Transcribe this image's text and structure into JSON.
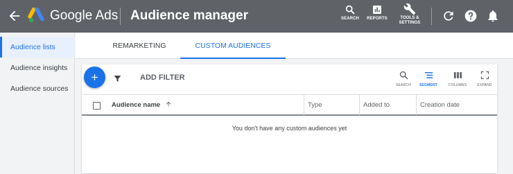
{
  "header": {
    "brand": "Google Ads",
    "title": "Audience manager",
    "tools": [
      {
        "icon": "search-icon",
        "label": "SEARCH"
      },
      {
        "icon": "reports-icon",
        "label": "REPORTS"
      },
      {
        "icon": "wrench-icon",
        "label_line1": "TOOLS &",
        "label_line2": "SETTINGS"
      }
    ],
    "icons": [
      "refresh-icon",
      "help-icon",
      "notifications-bell-icon"
    ]
  },
  "sidebar": {
    "items": [
      {
        "label": "Audience lists",
        "active": true
      },
      {
        "label": "Audience insights",
        "active": false
      },
      {
        "label": "Audience sources",
        "active": false
      }
    ]
  },
  "tabs": [
    {
      "label": "REMARKETING",
      "active": false
    },
    {
      "label": "CUSTOM AUDIENCES",
      "active": true
    }
  ],
  "toolbar": {
    "add_filter": "ADD FILTER",
    "tools": [
      {
        "icon": "search-icon",
        "label": "SEARCH"
      },
      {
        "icon": "segment-icon",
        "label": "SEGMENT"
      },
      {
        "icon": "columns-icon",
        "label": "COLUMNS"
      },
      {
        "icon": "expand-icon",
        "label": "EXPAND"
      }
    ]
  },
  "table": {
    "columns": [
      "Audience name",
      "Type",
      "Added to",
      "Creation date"
    ],
    "empty_message": "You don't have any custom audiences yet"
  },
  "colors": {
    "header_bg": "#5f6368",
    "accent": "#1a73e8",
    "sidebar_active_bg": "#e8f0fe"
  }
}
